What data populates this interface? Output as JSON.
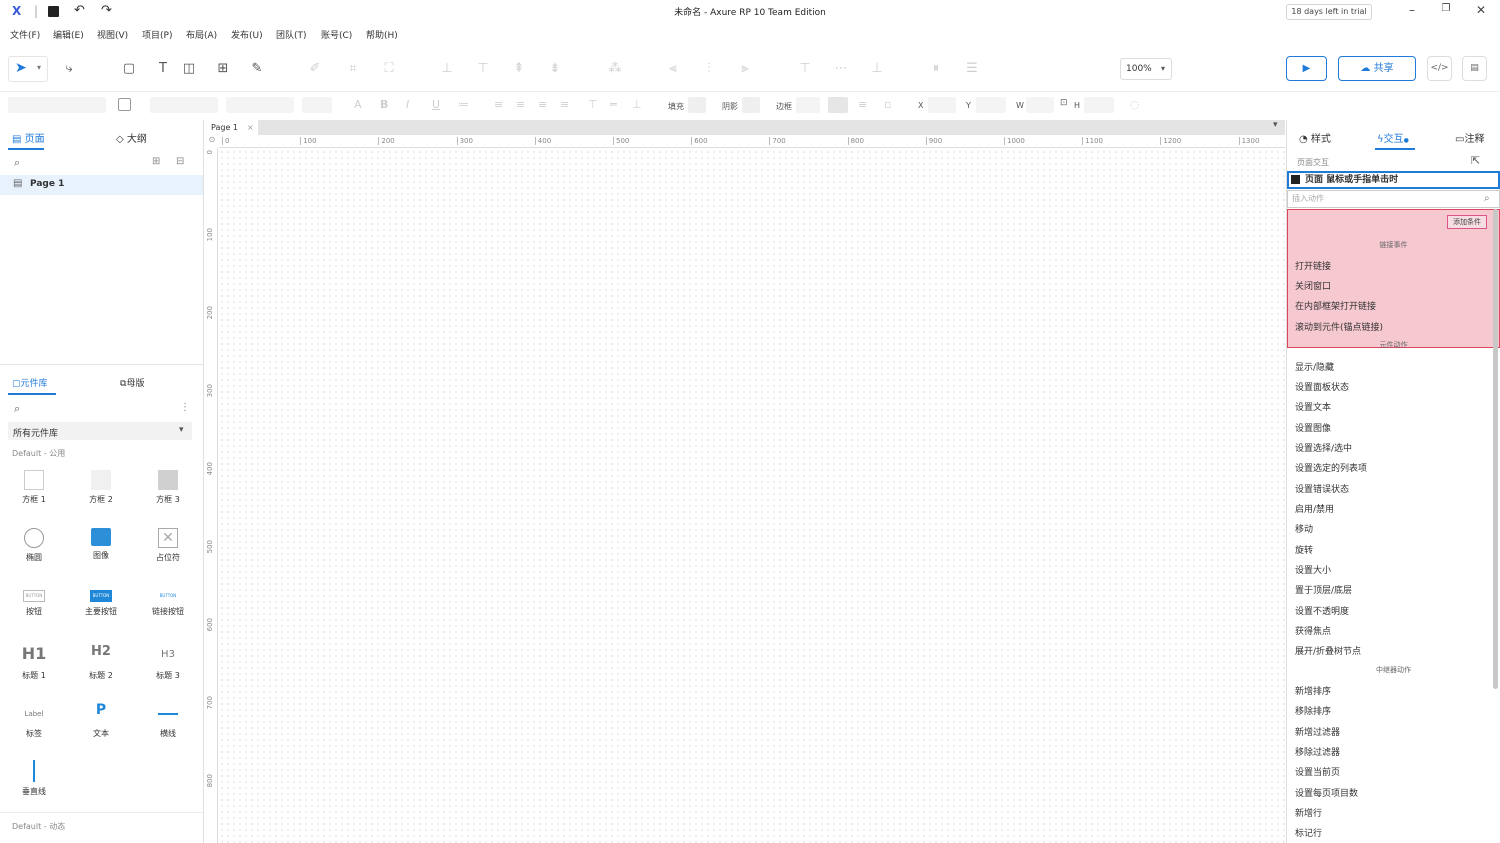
{
  "window": {
    "app_icon": "X",
    "title": "未命名 - Axure RP 10 Team Edition",
    "trial": "18 days left in trial"
  },
  "menu": [
    "文件(F)",
    "编辑(E)",
    "视图(V)",
    "项目(P)",
    "布局(A)",
    "发布(U)",
    "团队(T)",
    "账号(C)",
    "帮助(H)"
  ],
  "toolbar": {
    "zoom": "100%",
    "share_label": "共享",
    "code_label": "</>"
  },
  "format_bar": {
    "fill_label": "填充",
    "shadow_label": "阴影",
    "border_label": "边框",
    "x_label": "X",
    "y_label": "Y",
    "w_label": "W",
    "h_label": "H"
  },
  "left_panel": {
    "tabs": [
      "页面",
      "大纲"
    ],
    "pages": [
      "Page 1"
    ],
    "lib_tabs": [
      "元件库",
      "母版"
    ],
    "lib_select": "所有元件库",
    "section_default": "Default - 公用",
    "section_dynamic": "Default - 动态",
    "widgets": [
      "方框 1",
      "方框 2",
      "方框 3",
      "椭圆",
      "图像",
      "占位符",
      "按钮",
      "主要按钮",
      "链接按钮",
      "标题 1",
      "标题 2",
      "标题 3",
      "标签",
      "文本",
      "横线",
      "垂直线"
    ],
    "widget_glyphs": {
      "h1": "H1",
      "h2": "H2",
      "h3": "H3",
      "label": "Label",
      "button": "BUTTON",
      "p": "P"
    }
  },
  "canvas": {
    "page_tab": "Page 1",
    "h_ticks": [
      "0",
      "100",
      "200",
      "300",
      "400",
      "500",
      "600",
      "700",
      "800",
      "900",
      "1000",
      "1100",
      "1200",
      "1300"
    ],
    "v_ticks": [
      "0",
      "100",
      "200",
      "300",
      "400",
      "500",
      "600",
      "700",
      "800"
    ]
  },
  "right_panel": {
    "tabs": [
      "样式",
      "交互",
      "注释"
    ],
    "page_interaction_label": "页面交互",
    "event_title": "页面 鼠标或手指单击时",
    "search_placeholder": "插入动作",
    "add_condition": "添加条件",
    "section_link": "链接事件",
    "link_actions": [
      "打开链接",
      "关闭窗口",
      "在内部框架打开链接",
      "滚动到元件(锚点链接)"
    ],
    "section_widget": "元件动作",
    "widget_actions": [
      "显示/隐藏",
      "设置面板状态",
      "设置文本",
      "设置图像",
      "设置选择/选中",
      "设置选定的列表项",
      "设置错误状态",
      "启用/禁用",
      "移动",
      "旋转",
      "设置大小",
      "置于顶层/底层",
      "设置不透明度",
      "获得焦点",
      "展开/折叠树节点"
    ],
    "section_repeater": "中继器动作",
    "repeater_actions": [
      "新增排序",
      "移除排序",
      "新增过滤器",
      "移除过滤器",
      "设置当前页",
      "设置每页项目数",
      "新增行",
      "标记行"
    ]
  },
  "colors": {
    "accent": "#1f7ad8",
    "highlight_fill": "#f6c8d0",
    "highlight_border": "#e0455f"
  }
}
